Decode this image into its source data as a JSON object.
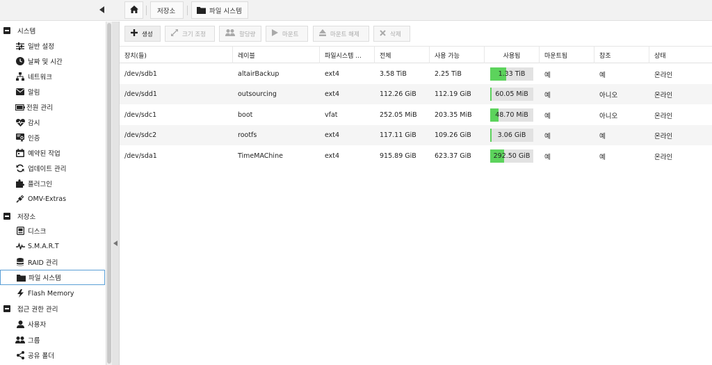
{
  "topbar": {
    "collapse_icon": "triangle-left-icon",
    "home_icon": "home-icon",
    "crumb_storage": "저장소",
    "crumb_fs": "파일 시스템",
    "crumb_fs_icon": "folder-icon"
  },
  "sidebar": {
    "groups": [
      {
        "label": "시스템",
        "icon": "minus-square-icon"
      },
      {
        "label": "저장소",
        "icon": "minus-square-icon"
      },
      {
        "label": "접근 권한 관리",
        "icon": "minus-square-icon"
      }
    ],
    "items": [
      {
        "label": "일반 설정",
        "icon": "sliders-icon"
      },
      {
        "label": "날짜 및 시간",
        "icon": "clock-icon"
      },
      {
        "label": "네트워크",
        "icon": "network-icon"
      },
      {
        "label": "알림",
        "icon": "envelope-icon"
      },
      {
        "label": "전원 관리",
        "icon": "battery-icon"
      },
      {
        "label": "감시",
        "icon": "heartbeat-icon"
      },
      {
        "label": "인증",
        "icon": "certificate-icon"
      },
      {
        "label": "예약된 작업",
        "icon": "calendar-icon"
      },
      {
        "label": "업데이트 관리",
        "icon": "refresh-icon"
      },
      {
        "label": "플러그인",
        "icon": "puzzle-icon"
      },
      {
        "label": "OMV-Extras",
        "icon": "plug-icon"
      },
      {
        "label": "디스크",
        "icon": "disk-icon"
      },
      {
        "label": "S.M.A.R.T",
        "icon": "pulse-icon"
      },
      {
        "label": "RAID 관리",
        "icon": "database-icon"
      },
      {
        "label": "파일 시스템",
        "icon": "folder-icon"
      },
      {
        "label": "Flash Memory",
        "icon": "flash-icon"
      },
      {
        "label": "사용자",
        "icon": "user-icon"
      },
      {
        "label": "그룹",
        "icon": "users-icon"
      },
      {
        "label": "공유 폴더",
        "icon": "share-icon"
      }
    ]
  },
  "toolbar": {
    "create": "생성",
    "resize": "크기 조정",
    "quota": "할당량",
    "mount": "마운트",
    "unmount": "마운트 해제",
    "delete": "삭제"
  },
  "grid": {
    "columns": [
      "장치(들)",
      "레이블",
      "파일시스템 ...",
      "전체",
      "사용 가능",
      "사용됨",
      "마운트됨",
      "참조",
      "상태"
    ],
    "rows": [
      {
        "device": "/dev/sdb1",
        "label": "altairBackup",
        "fs": "ext4",
        "total": "3.58 TiB",
        "available": "2.25 TiB",
        "used": "1.33 TiB",
        "used_pct": 0.37,
        "mounted": "예",
        "referenced": "예",
        "status": "온라인"
      },
      {
        "device": "/dev/sdd1",
        "label": "outsourcing",
        "fs": "ext4",
        "total": "112.26 GiB",
        "available": "112.19 GiB",
        "used": "60.05 MiB",
        "used_pct": 0.01,
        "mounted": "예",
        "referenced": "아니오",
        "status": "온라인"
      },
      {
        "device": "/dev/sdc1",
        "label": "boot",
        "fs": "vfat",
        "total": "252.05 MiB",
        "available": "203.35 MiB",
        "used": "48.70 MiB",
        "used_pct": 0.19,
        "mounted": "예",
        "referenced": "아니오",
        "status": "온라인"
      },
      {
        "device": "/dev/sdc2",
        "label": "rootfs",
        "fs": "ext4",
        "total": "117.11 GiB",
        "available": "109.26 GiB",
        "used": "3.06 GiB",
        "used_pct": 0.03,
        "mounted": "예",
        "referenced": "예",
        "status": "온라인"
      },
      {
        "device": "/dev/sda1",
        "label": "TimeMAChine",
        "fs": "ext4",
        "total": "915.89 GiB",
        "available": "623.37 GiB",
        "used": "292.50 GiB",
        "used_pct": 0.32,
        "mounted": "예",
        "referenced": "예",
        "status": "온라인"
      }
    ]
  }
}
